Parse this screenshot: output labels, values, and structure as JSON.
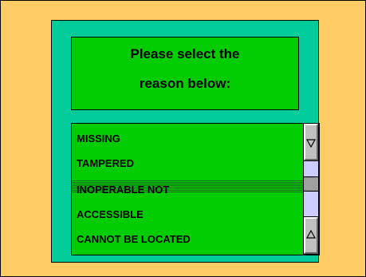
{
  "prompt": {
    "line1": "Please select the",
    "line2": "reason below:"
  },
  "reasons": [
    "MISSING",
    "TAMPERED",
    "INOPERABLE NOT",
    "ACCESSIBLE",
    "CANNOT BE LOCATED"
  ],
  "selected_index": 2,
  "scrollbar": {
    "up_icon": "triangle-up-outline-icon",
    "down_icon": "triangle-down-outline-icon"
  },
  "colors": {
    "background": "#FFCC66",
    "panel": "#00CC99",
    "box": "#00CC00",
    "scroll_track": "#CCCCFF"
  }
}
